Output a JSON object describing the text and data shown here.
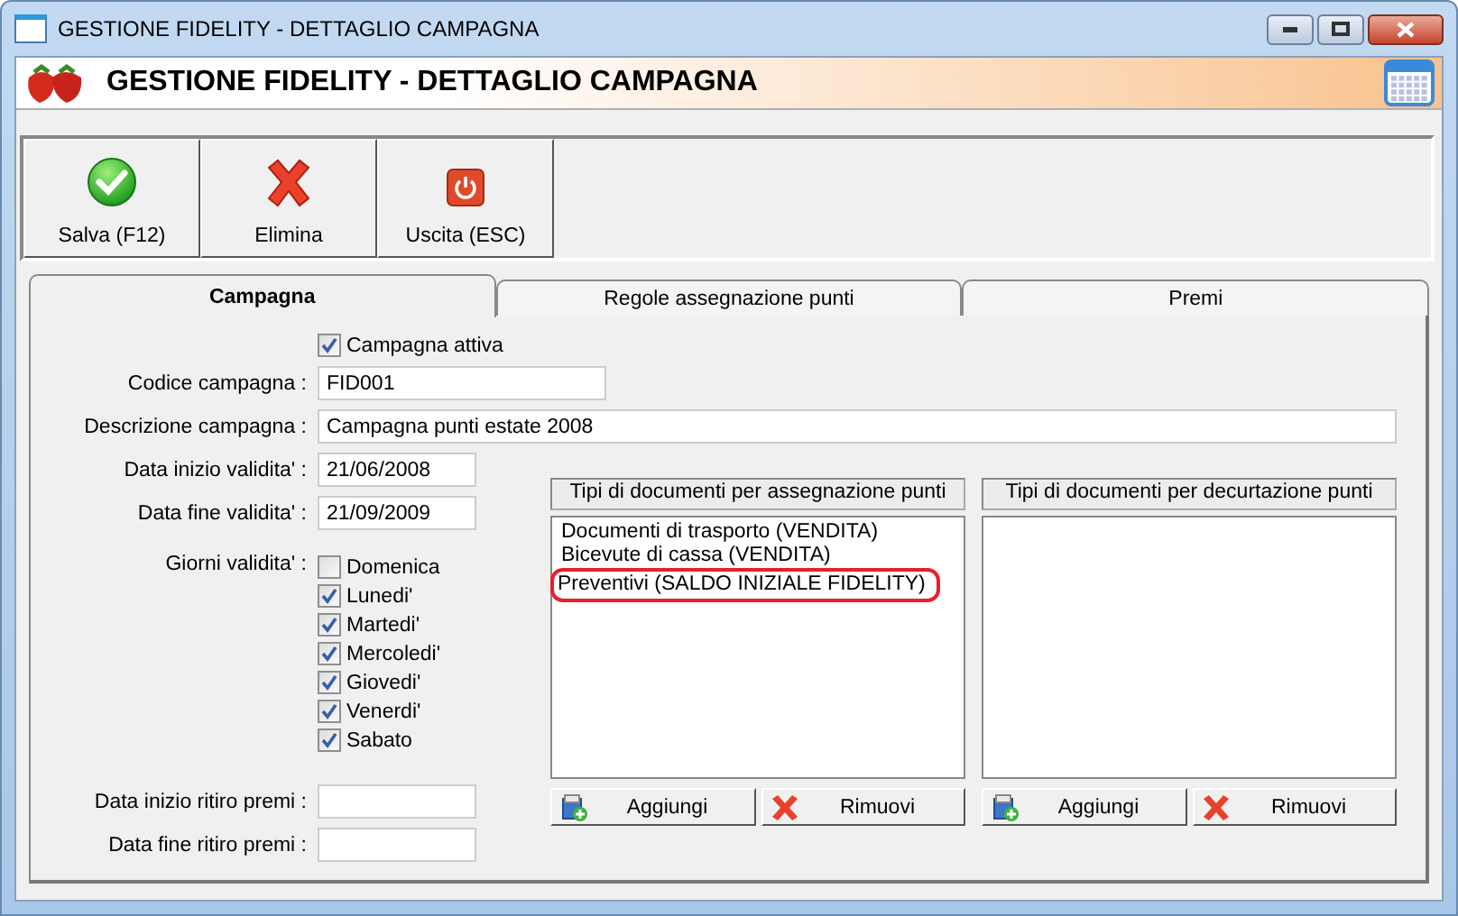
{
  "window": {
    "title": "GESTIONE FIDELITY - DETTAGLIO CAMPAGNA"
  },
  "header": {
    "title": "GESTIONE FIDELITY - DETTAGLIO CAMPAGNA"
  },
  "toolbar": [
    {
      "label": "Salva (F12)",
      "kind": "save"
    },
    {
      "label": "Elimina",
      "kind": "delete"
    },
    {
      "label": "Uscita (ESC)",
      "kind": "exit"
    }
  ],
  "tabs": [
    {
      "label": "Campagna",
      "selected": true
    },
    {
      "label": "Regole assegnazione punti",
      "selected": false
    },
    {
      "label": "Premi",
      "selected": false
    }
  ],
  "active": {
    "label": "Campagna attiva",
    "checked": true
  },
  "code": {
    "label": "Codice campagna :",
    "value": "FID001"
  },
  "description": {
    "label": "Descrizione campagna :",
    "value": "Campagna punti estate 2008"
  },
  "start_date": {
    "label": "Data inizio validita' :",
    "value": "21/06/2008"
  },
  "end_date": {
    "label": "Data fine validita' :",
    "value": "21/09/2009"
  },
  "days": {
    "label": "Giorni validita' :",
    "items": [
      {
        "label": "Domenica",
        "checked": false
      },
      {
        "label": "Lunedi'",
        "checked": true
      },
      {
        "label": "Martedi'",
        "checked": true
      },
      {
        "label": "Mercoledi'",
        "checked": true
      },
      {
        "label": "Giovedi'",
        "checked": true
      },
      {
        "label": "Venerdi'",
        "checked": true
      },
      {
        "label": "Sabato",
        "checked": true
      }
    ]
  },
  "prize_start": {
    "label": "Data inizio ritiro premi :"
  },
  "prize_end": {
    "label": "Data fine ritiro premi :"
  },
  "lists": [
    {
      "header": "Tipi di documenti per assegnazione punti",
      "items": [
        {
          "label": "Documenti di trasporto (VENDITA)",
          "circled": false
        },
        {
          "label": "Bicevute di cassa (VENDITA)",
          "circled": false
        },
        {
          "label": "Preventivi (SALDO INIZIALE FIDELITY)",
          "circled": true
        }
      ],
      "buttons": [
        {
          "label": "Aggiungi",
          "kind": "add"
        },
        {
          "label": "Rimuovi",
          "kind": "remove"
        }
      ]
    },
    {
      "header": "Tipi di documenti per decurtazione punti",
      "buttons": [
        {
          "label": "Aggiungi",
          "kind": "add"
        },
        {
          "label": "Rimuovi",
          "kind": "remove"
        }
      ]
    }
  ]
}
